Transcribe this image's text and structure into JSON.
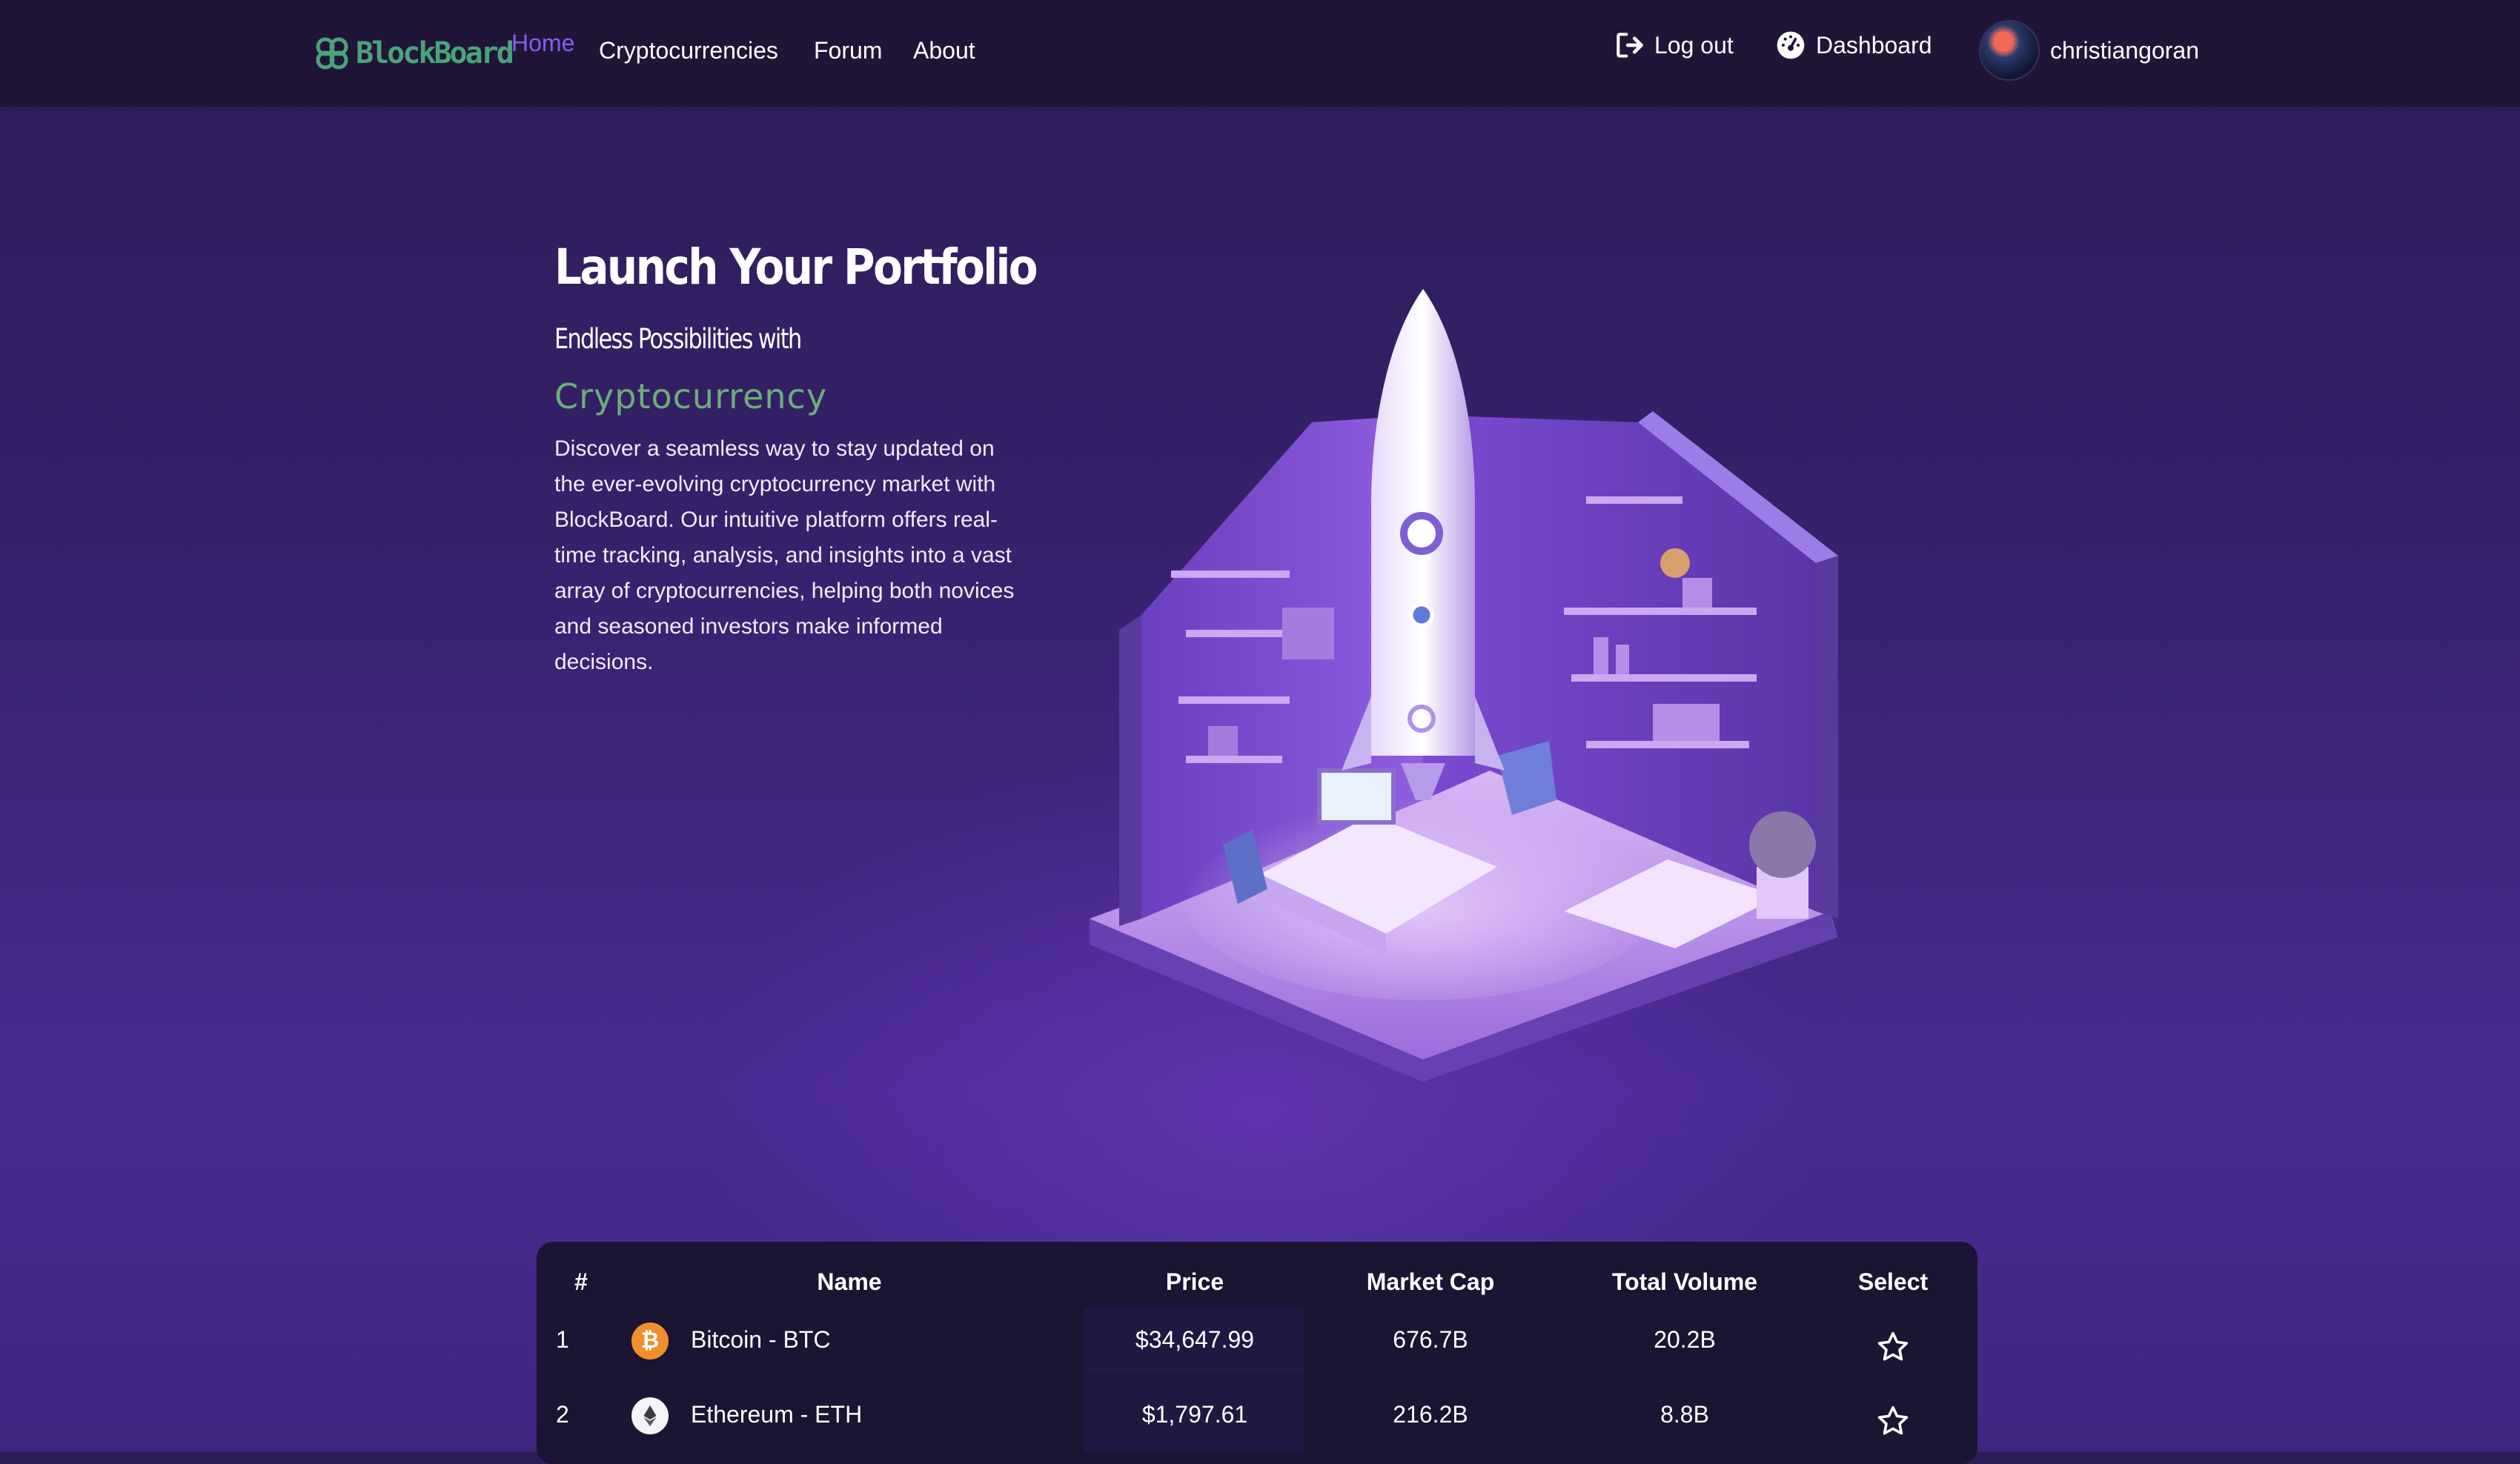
{
  "brand": {
    "name": "BlockBoard",
    "color": "#4aa37a"
  },
  "nav": {
    "home": "Home",
    "cryptocurrencies": "Cryptocurrencies",
    "forum": "Forum",
    "about": "About",
    "active": "Home",
    "active_color": "#8a5cf0"
  },
  "user_menu": {
    "logout": "Log out",
    "dashboard": "Dashboard",
    "username": "christiangoran"
  },
  "hero": {
    "title": "Launch Your Portfolio",
    "subtitle": "Endless Possibilities with",
    "accent": "Cryptocurrency",
    "accent_color": "#6cae78",
    "description": "Discover a seamless way to stay updated on the ever-evolving cryptocurrency market with BlockBoard. Our intuitive platform offers real-time tracking, analysis, and insights into a vast array of cryptocurrencies, helping both novices and seasoned investors make informed decisions."
  },
  "table": {
    "headers": {
      "rank": "#",
      "name": "Name",
      "price": "Price",
      "market_cap": "Market Cap",
      "total_volume": "Total Volume",
      "select": "Select"
    },
    "rows": [
      {
        "rank": "1",
        "icon": "bitcoin-icon",
        "name": "Bitcoin - BTC",
        "price": "$34,647.99",
        "market_cap": "676.7B",
        "total_volume": "20.2B",
        "selected": false
      },
      {
        "rank": "2",
        "icon": "ethereum-icon",
        "name": "Ethereum - ETH",
        "price": "$1,797.61",
        "market_cap": "216.2B",
        "total_volume": "8.8B",
        "selected": false
      }
    ]
  }
}
